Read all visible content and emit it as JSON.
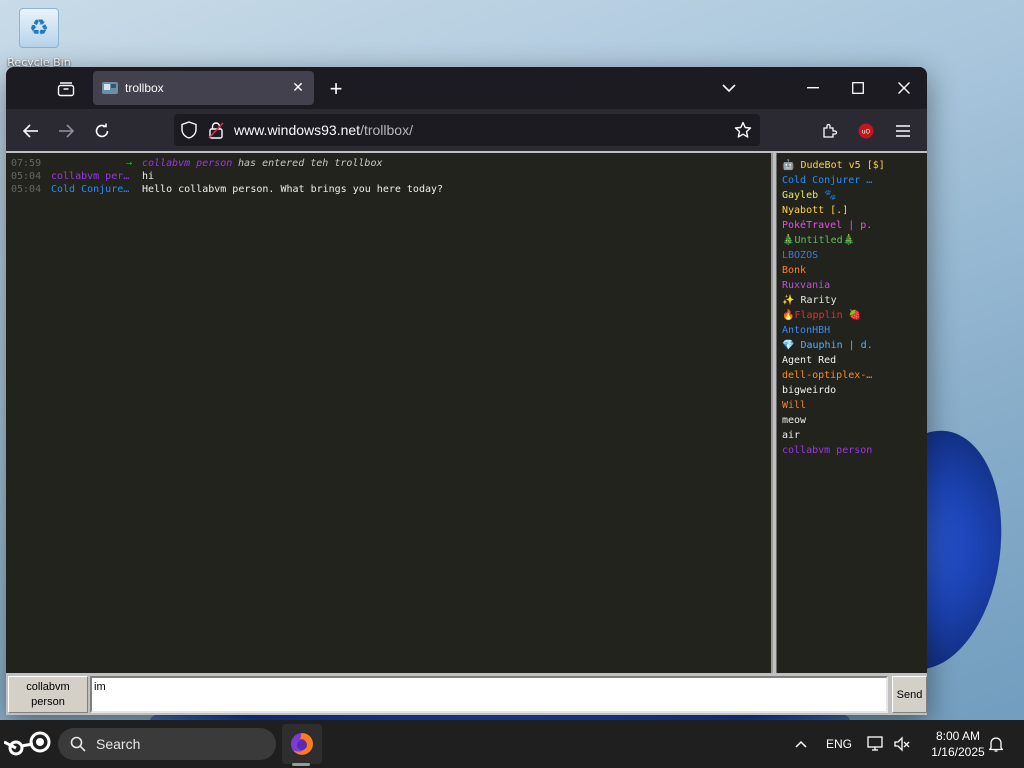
{
  "desktop": {
    "icons": [
      {
        "label": "Recycle Bin",
        "icon": "recycle-bin-icon"
      }
    ]
  },
  "browser": {
    "tab": {
      "title": "trollbox",
      "favicon": "trollbox-favicon"
    },
    "url": {
      "domain": "www.windows93.net",
      "path": "/trollbox/"
    }
  },
  "chat": {
    "messages": [
      {
        "time": "07:59",
        "type": "system",
        "arrow": "→",
        "nick": "collabvm person",
        "text": "has entered teh trollbox",
        "nick_color": "#9b35e8"
      },
      {
        "time": "05:04",
        "type": "message",
        "nick": "collabvm per…",
        "text": "hi",
        "nick_color": "#9b35e8"
      },
      {
        "time": "05:04",
        "type": "message",
        "nick": "Cold Conjure…",
        "text": "Hello collabvm person. What brings you here today?",
        "nick_color": "#1e90ff"
      }
    ]
  },
  "users": [
    {
      "name": "🤖 DudeBot v5 [$]",
      "color": "#ffd24a"
    },
    {
      "name": "Cold Conjurer …",
      "color": "#1e90ff"
    },
    {
      "name": "Gayleb 🐾",
      "color": "#e8e86a"
    },
    {
      "name": "Nyabott [.]",
      "color": "#ffd24a"
    },
    {
      "name": "PokéTravel | p.",
      "color": "#e84fe8"
    },
    {
      "name": "🎄Untitled🎄",
      "color": "#5fbf5f"
    },
    {
      "name": "LBOZOS",
      "color": "#3a7bd5"
    },
    {
      "name": "Bonk",
      "color": "#ff7f27"
    },
    {
      "name": "Ruxvania",
      "color": "#c050e0"
    },
    {
      "name": "✨ Rarity",
      "color": "#e6e6e6"
    },
    {
      "name": "🔥Flapplin 🍓",
      "color": "#e03030"
    },
    {
      "name": "AntonHBH",
      "color": "#3a8ae8"
    },
    {
      "name": "💎 Dauphin | d.",
      "color": "#4fb0ff"
    },
    {
      "name": "Agent Red",
      "color": "#f0f0f0"
    },
    {
      "name": "dell-optiplex-…",
      "color": "#ff8c1a"
    },
    {
      "name": "bigweirdo",
      "color": "#f0f0f0"
    },
    {
      "name": "Will",
      "color": "#ff7f27"
    },
    {
      "name": "meow",
      "color": "#f0f0f0"
    },
    {
      "name": "air",
      "color": "#f0f0f0"
    },
    {
      "name": "collabvm person",
      "color": "#9b35e8"
    }
  ],
  "compose": {
    "nick_line1": "collabvm",
    "nick_line2": "person",
    "input_value": "im",
    "send_label": "Send"
  },
  "taskbar": {
    "search_label": "Search",
    "language": "ENG",
    "time": "8:00 AM",
    "date": "1/16/2025"
  }
}
